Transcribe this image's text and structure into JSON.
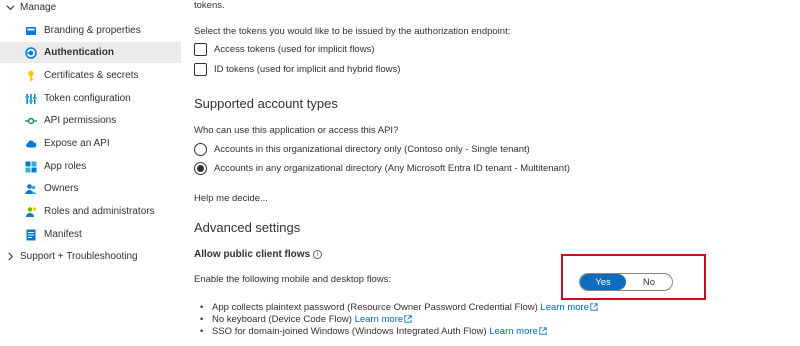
{
  "sidebar": {
    "manage_label": "Manage",
    "items": [
      {
        "label": "Branding & properties",
        "icon": "branding-icon",
        "active": false
      },
      {
        "label": "Authentication",
        "icon": "authentication-icon",
        "active": true
      },
      {
        "label": "Certificates & secrets",
        "icon": "key-icon",
        "active": false
      },
      {
        "label": "Token configuration",
        "icon": "token-config-icon",
        "active": false
      },
      {
        "label": "API permissions",
        "icon": "api-permissions-icon",
        "active": false
      },
      {
        "label": "Expose an API",
        "icon": "cloud-icon",
        "active": false
      },
      {
        "label": "App roles",
        "icon": "app-roles-icon",
        "active": false
      },
      {
        "label": "Owners",
        "icon": "owners-icon",
        "active": false
      },
      {
        "label": "Roles and administrators",
        "icon": "roles-admins-icon",
        "active": false
      },
      {
        "label": "Manifest",
        "icon": "manifest-icon",
        "active": false
      }
    ],
    "support_label": "Support + Troubleshooting"
  },
  "main": {
    "top_link": "tokens.",
    "tokens_prompt": "Select the tokens you would like to be issued by the authorization endpoint:",
    "access_tokens_label": "Access tokens (used for implicit flows)",
    "id_tokens_label": "ID tokens (used for implicit and hybrid flows)",
    "account_types_title": "Supported account types",
    "account_question": "Who can use this application or access this API?",
    "single_tenant_label": "Accounts in this organizational directory only (Contoso only - Single tenant)",
    "multi_tenant_label": "Accounts in any organizational directory (Any Microsoft Entra ID tenant - Multitenant)",
    "help_link": "Help me decide...",
    "advanced_title": "Advanced settings",
    "public_flows_label": "Allow public client flows",
    "enable_flows_label": "Enable the following mobile and desktop flows:",
    "toggle_yes": "Yes",
    "toggle_no": "No",
    "flows": [
      {
        "text": "App collects plaintext password (Resource Owner Password Credential Flow)",
        "link": "Learn more"
      },
      {
        "text": "No keyboard (Device Code Flow)",
        "link": "Learn more"
      },
      {
        "text": "SSO for domain-joined Windows (Windows Integrated Auth Flow)",
        "link": "Learn more"
      }
    ]
  },
  "colors": {
    "accent": "#0f6cbd",
    "link": "#0067b8",
    "highlight": "#c50f1f",
    "active_bg": "#edebe9"
  }
}
